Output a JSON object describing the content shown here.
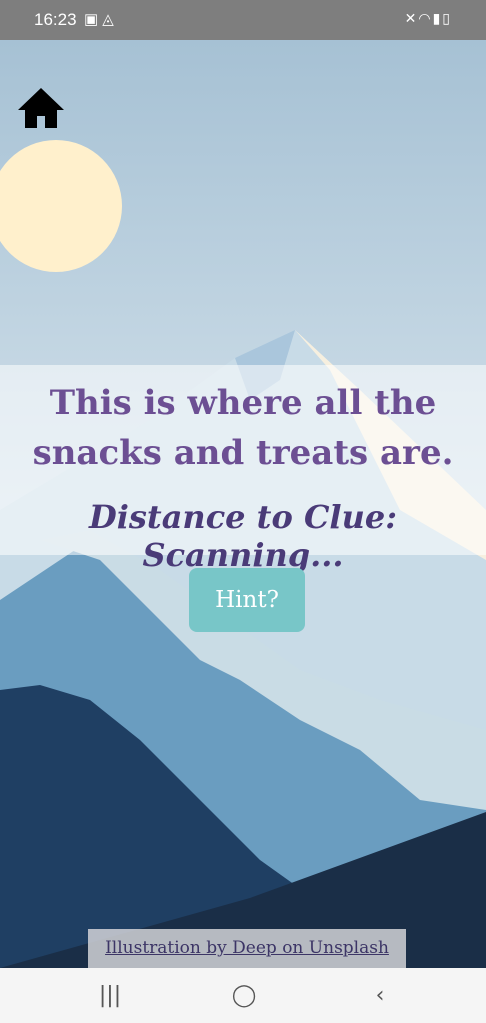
{
  "status_bar": {
    "time": "16:23",
    "left_icons": [
      "image-icon",
      "drive-icon"
    ],
    "right_icons": [
      "mute-icon",
      "wifi-icon",
      "signal-icon",
      "battery-icon"
    ]
  },
  "header": {
    "home_icon": "home-icon"
  },
  "clue": {
    "message": "This is where all the snacks and treats are.",
    "distance": "Distance to Clue: Scanning..."
  },
  "hint_button": {
    "label": "Hint?"
  },
  "credit": {
    "text": "Illustration by Deep on Unsplash"
  },
  "nav_bar": {
    "recent_label": "|||",
    "home_label": "◯",
    "back_label": "‹"
  },
  "colors": {
    "sky_top": "#a5c0d3",
    "sky_bottom": "#e7eff4",
    "sun": "#fff0cc",
    "title_text": "#6c4f93",
    "distance_text": "#4a3b78",
    "hint_button": "#78c6c8",
    "mountain_dark": "#1f3f63",
    "mountain_mid": "#6a9dc0"
  }
}
